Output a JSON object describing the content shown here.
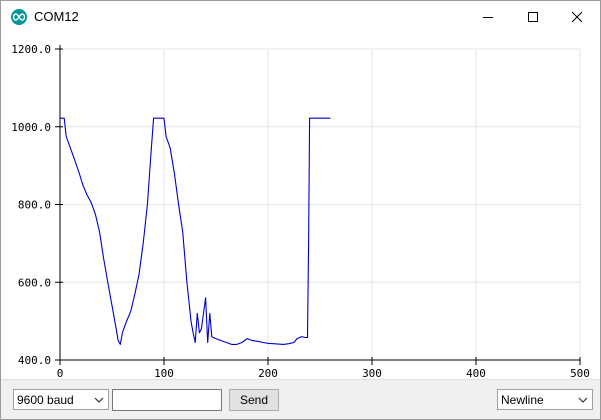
{
  "window": {
    "title": "COM12",
    "icon": "arduino-infinity-icon",
    "controls": [
      "minimize-icon",
      "maximize-icon",
      "close-icon"
    ]
  },
  "chart_data": {
    "type": "line",
    "title": "",
    "xlabel": "",
    "ylabel": "",
    "xlim": [
      0,
      500
    ],
    "ylim": [
      400,
      1200
    ],
    "x_ticks": [
      "0",
      "100",
      "200",
      "300",
      "400",
      "500"
    ],
    "y_ticks": [
      "400.0",
      "600.0",
      "800.0",
      "1000.0",
      "1200.0"
    ],
    "x_tick_values": [
      0,
      100,
      200,
      300,
      400,
      500
    ],
    "y_tick_values": [
      400,
      600,
      800,
      1000,
      1200
    ],
    "grid": true,
    "series": [
      {
        "color": "#0000cc",
        "points": [
          [
            0,
            1022
          ],
          [
            4,
            1022
          ],
          [
            6,
            975
          ],
          [
            10,
            945
          ],
          [
            14,
            915
          ],
          [
            18,
            885
          ],
          [
            22,
            850
          ],
          [
            26,
            825
          ],
          [
            30,
            805
          ],
          [
            34,
            775
          ],
          [
            38,
            730
          ],
          [
            42,
            660
          ],
          [
            46,
            600
          ],
          [
            50,
            540
          ],
          [
            54,
            480
          ],
          [
            56,
            450
          ],
          [
            58,
            440
          ],
          [
            60,
            470
          ],
          [
            64,
            500
          ],
          [
            68,
            525
          ],
          [
            72,
            570
          ],
          [
            76,
            620
          ],
          [
            80,
            700
          ],
          [
            84,
            800
          ],
          [
            88,
            950
          ],
          [
            90,
            1022
          ],
          [
            94,
            1022
          ],
          [
            100,
            1022
          ],
          [
            102,
            975
          ],
          [
            106,
            945
          ],
          [
            110,
            880
          ],
          [
            114,
            800
          ],
          [
            118,
            730
          ],
          [
            122,
            600
          ],
          [
            124,
            550
          ],
          [
            126,
            500
          ],
          [
            128,
            470
          ],
          [
            130,
            445
          ],
          [
            132,
            520
          ],
          [
            134,
            470
          ],
          [
            136,
            480
          ],
          [
            138,
            520
          ],
          [
            140,
            560
          ],
          [
            142,
            445
          ],
          [
            144,
            520
          ],
          [
            146,
            460
          ],
          [
            150,
            455
          ],
          [
            155,
            450
          ],
          [
            160,
            445
          ],
          [
            165,
            440
          ],
          [
            170,
            440
          ],
          [
            175,
            445
          ],
          [
            180,
            455
          ],
          [
            185,
            450
          ],
          [
            190,
            448
          ],
          [
            195,
            445
          ],
          [
            200,
            443
          ],
          [
            210,
            441
          ],
          [
            215,
            440
          ],
          [
            220,
            442
          ],
          [
            225,
            445
          ],
          [
            228,
            455
          ],
          [
            232,
            460
          ],
          [
            236,
            458
          ],
          [
            238,
            458
          ],
          [
            239,
            700
          ],
          [
            240,
            1022
          ],
          [
            250,
            1022
          ],
          [
            260,
            1022
          ]
        ]
      }
    ]
  },
  "footer": {
    "baud": {
      "value": "9600 baud"
    },
    "message_input": {
      "value": "",
      "placeholder": ""
    },
    "send_label": "Send",
    "line_ending": {
      "value": "Newline"
    }
  }
}
